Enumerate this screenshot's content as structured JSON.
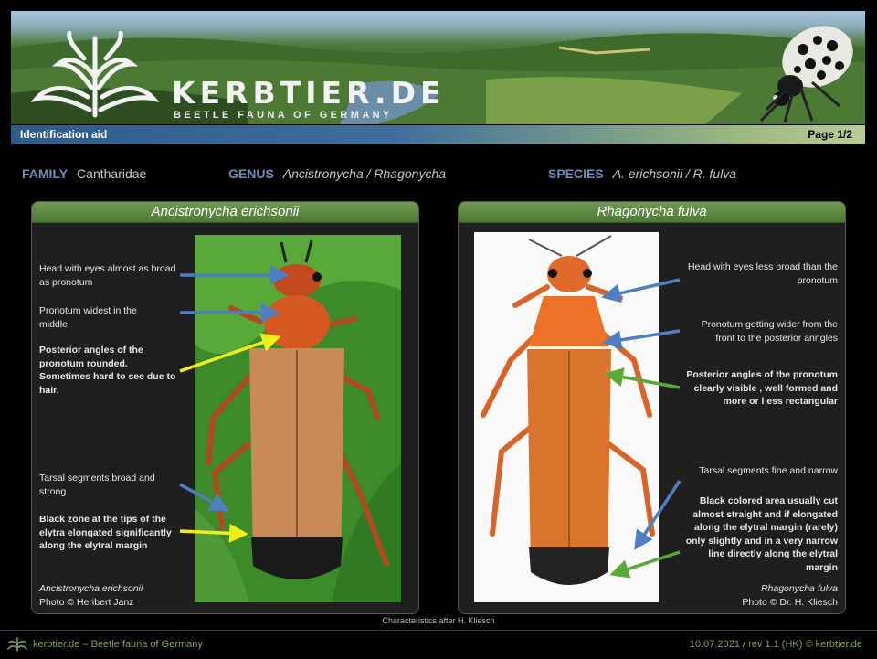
{
  "banner": {
    "site_name": "KERBTIER.DE",
    "tagline": "BEETLE FAUNA OF GERMANY"
  },
  "titlebar": {
    "left": "Identification aid",
    "right": "Page 1/2"
  },
  "taxonomy": {
    "family_label": "FAMILY",
    "family_value": "Cantharidae",
    "genus_label": "GENUS",
    "genus_value": "Ancistronycha / Rhagonycha",
    "species_label": "SPECIES",
    "species_value": "A. erichsonii / R. fulva"
  },
  "left_panel": {
    "title": "Ancistronycha erichsonii",
    "notes": [
      "Head with eyes almost as broad as pronotum",
      "Pronotum widest in the middle",
      "Posterior angles of the pronotum rounded. Sometimes hard to see due to hair.",
      "Tarsal segments broad and strong",
      "Black zone at the tips of the elytra elongated significantly along the elytral margin"
    ],
    "credit_species": "Ancistronycha erichsonii",
    "credit_photo": "Photo © Heribert Janz"
  },
  "right_panel": {
    "title": "Rhagonycha fulva",
    "notes": [
      "Head with eyes less broad than the pronotum",
      "Pronotum getting wider from the front to the posterior anngles",
      "Posterior angles of the pronotum clearly visible , well formed and more or l ess rectangular",
      "Tarsal segments fine and narrow",
      "Black colored area usually cut almost straight and if elongated along the elytral margin (rarely) only slightly and in a very narrow line directly along the elytral margin"
    ],
    "credit_species": "Rhagonycha fulva",
    "credit_photo": "Photo © Dr. H. Kliesch"
  },
  "footnote": "Characteristics after H. Kliesch",
  "footer": {
    "left": "kerbtier.de – Beetle fauna of Germany",
    "right": "10.07.2021 / rev 1.1 (HK) © kerbtier.de"
  },
  "colors": {
    "arrow_blue": "#4f7fc0",
    "arrow_yellow": "#f2ee1a",
    "arrow_green": "#5aa83a",
    "label_blue": "#6f8fb8",
    "footer_green": "#7fa15e"
  }
}
